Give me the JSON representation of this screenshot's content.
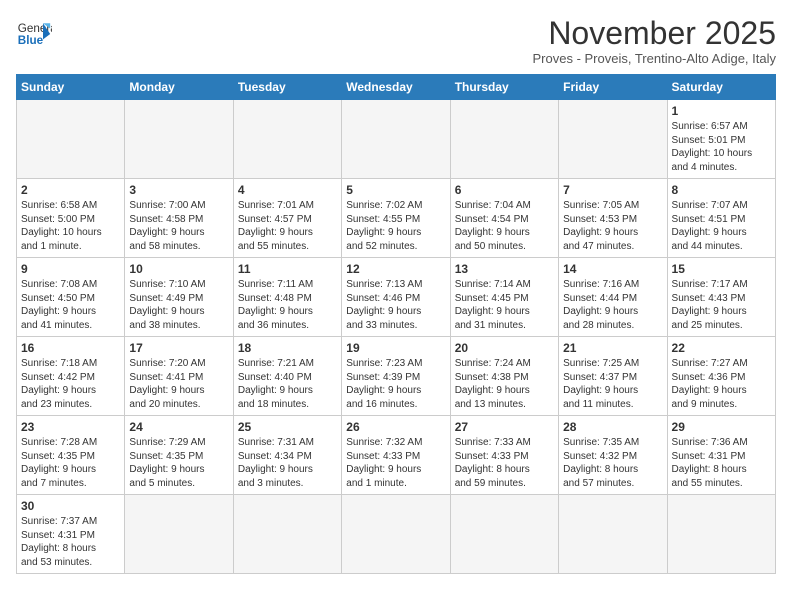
{
  "header": {
    "logo_line1": "General",
    "logo_line2": "Blue",
    "month_title": "November 2025",
    "subtitle": "Proves - Proveis, Trentino-Alto Adige, Italy"
  },
  "weekdays": [
    "Sunday",
    "Monday",
    "Tuesday",
    "Wednesday",
    "Thursday",
    "Friday",
    "Saturday"
  ],
  "weeks": [
    [
      {
        "day": "",
        "info": ""
      },
      {
        "day": "",
        "info": ""
      },
      {
        "day": "",
        "info": ""
      },
      {
        "day": "",
        "info": ""
      },
      {
        "day": "",
        "info": ""
      },
      {
        "day": "",
        "info": ""
      },
      {
        "day": "1",
        "info": "Sunrise: 6:57 AM\nSunset: 5:01 PM\nDaylight: 10 hours\nand 4 minutes."
      }
    ],
    [
      {
        "day": "2",
        "info": "Sunrise: 6:58 AM\nSunset: 5:00 PM\nDaylight: 10 hours\nand 1 minute."
      },
      {
        "day": "3",
        "info": "Sunrise: 7:00 AM\nSunset: 4:58 PM\nDaylight: 9 hours\nand 58 minutes."
      },
      {
        "day": "4",
        "info": "Sunrise: 7:01 AM\nSunset: 4:57 PM\nDaylight: 9 hours\nand 55 minutes."
      },
      {
        "day": "5",
        "info": "Sunrise: 7:02 AM\nSunset: 4:55 PM\nDaylight: 9 hours\nand 52 minutes."
      },
      {
        "day": "6",
        "info": "Sunrise: 7:04 AM\nSunset: 4:54 PM\nDaylight: 9 hours\nand 50 minutes."
      },
      {
        "day": "7",
        "info": "Sunrise: 7:05 AM\nSunset: 4:53 PM\nDaylight: 9 hours\nand 47 minutes."
      },
      {
        "day": "8",
        "info": "Sunrise: 7:07 AM\nSunset: 4:51 PM\nDaylight: 9 hours\nand 44 minutes."
      }
    ],
    [
      {
        "day": "9",
        "info": "Sunrise: 7:08 AM\nSunset: 4:50 PM\nDaylight: 9 hours\nand 41 minutes."
      },
      {
        "day": "10",
        "info": "Sunrise: 7:10 AM\nSunset: 4:49 PM\nDaylight: 9 hours\nand 38 minutes."
      },
      {
        "day": "11",
        "info": "Sunrise: 7:11 AM\nSunset: 4:48 PM\nDaylight: 9 hours\nand 36 minutes."
      },
      {
        "day": "12",
        "info": "Sunrise: 7:13 AM\nSunset: 4:46 PM\nDaylight: 9 hours\nand 33 minutes."
      },
      {
        "day": "13",
        "info": "Sunrise: 7:14 AM\nSunset: 4:45 PM\nDaylight: 9 hours\nand 31 minutes."
      },
      {
        "day": "14",
        "info": "Sunrise: 7:16 AM\nSunset: 4:44 PM\nDaylight: 9 hours\nand 28 minutes."
      },
      {
        "day": "15",
        "info": "Sunrise: 7:17 AM\nSunset: 4:43 PM\nDaylight: 9 hours\nand 25 minutes."
      }
    ],
    [
      {
        "day": "16",
        "info": "Sunrise: 7:18 AM\nSunset: 4:42 PM\nDaylight: 9 hours\nand 23 minutes."
      },
      {
        "day": "17",
        "info": "Sunrise: 7:20 AM\nSunset: 4:41 PM\nDaylight: 9 hours\nand 20 minutes."
      },
      {
        "day": "18",
        "info": "Sunrise: 7:21 AM\nSunset: 4:40 PM\nDaylight: 9 hours\nand 18 minutes."
      },
      {
        "day": "19",
        "info": "Sunrise: 7:23 AM\nSunset: 4:39 PM\nDaylight: 9 hours\nand 16 minutes."
      },
      {
        "day": "20",
        "info": "Sunrise: 7:24 AM\nSunset: 4:38 PM\nDaylight: 9 hours\nand 13 minutes."
      },
      {
        "day": "21",
        "info": "Sunrise: 7:25 AM\nSunset: 4:37 PM\nDaylight: 9 hours\nand 11 minutes."
      },
      {
        "day": "22",
        "info": "Sunrise: 7:27 AM\nSunset: 4:36 PM\nDaylight: 9 hours\nand 9 minutes."
      }
    ],
    [
      {
        "day": "23",
        "info": "Sunrise: 7:28 AM\nSunset: 4:35 PM\nDaylight: 9 hours\nand 7 minutes."
      },
      {
        "day": "24",
        "info": "Sunrise: 7:29 AM\nSunset: 4:35 PM\nDaylight: 9 hours\nand 5 minutes."
      },
      {
        "day": "25",
        "info": "Sunrise: 7:31 AM\nSunset: 4:34 PM\nDaylight: 9 hours\nand 3 minutes."
      },
      {
        "day": "26",
        "info": "Sunrise: 7:32 AM\nSunset: 4:33 PM\nDaylight: 9 hours\nand 1 minute."
      },
      {
        "day": "27",
        "info": "Sunrise: 7:33 AM\nSunset: 4:33 PM\nDaylight: 8 hours\nand 59 minutes."
      },
      {
        "day": "28",
        "info": "Sunrise: 7:35 AM\nSunset: 4:32 PM\nDaylight: 8 hours\nand 57 minutes."
      },
      {
        "day": "29",
        "info": "Sunrise: 7:36 AM\nSunset: 4:31 PM\nDaylight: 8 hours\nand 55 minutes."
      }
    ],
    [
      {
        "day": "30",
        "info": "Sunrise: 7:37 AM\nSunset: 4:31 PM\nDaylight: 8 hours\nand 53 minutes."
      },
      {
        "day": "",
        "info": ""
      },
      {
        "day": "",
        "info": ""
      },
      {
        "day": "",
        "info": ""
      },
      {
        "day": "",
        "info": ""
      },
      {
        "day": "",
        "info": ""
      },
      {
        "day": "",
        "info": ""
      }
    ]
  ]
}
